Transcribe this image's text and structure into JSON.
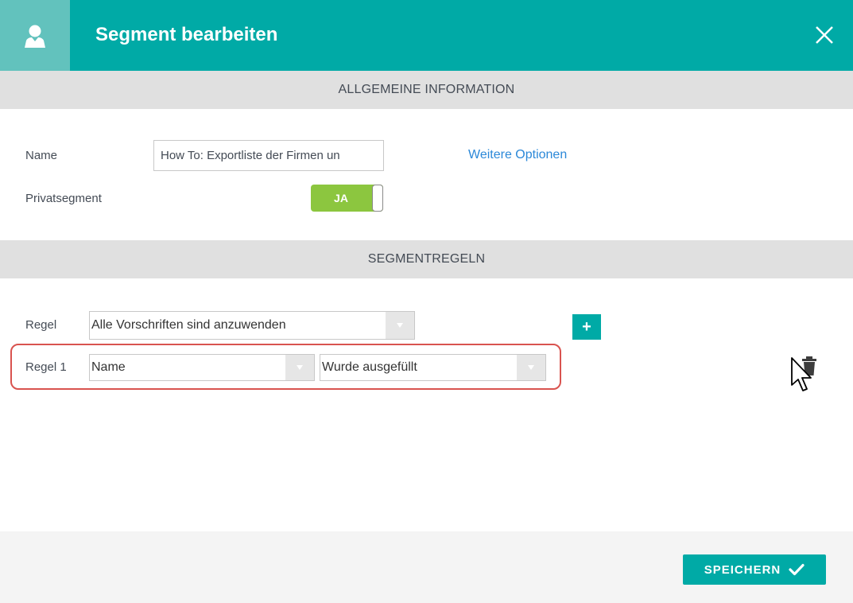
{
  "header": {
    "title": "Segment bearbeiten"
  },
  "sections": {
    "general": "ALLGEMEINE INFORMATION",
    "rules": "SEGMENTREGELN"
  },
  "general": {
    "name_label": "Name",
    "name_value": "How To: Exportliste der Firmen un",
    "more_options_link": "Weitere Optionen",
    "private_label": "Privatsegment",
    "private_toggle": "JA"
  },
  "rules": {
    "rule_label": "Regel",
    "rule_select_value": "Alle Vorschriften sind anzuwenden",
    "rule1_label": "Regel 1",
    "rule1_field_value": "Name",
    "rule1_condition_value": "Wurde ausgefüllt",
    "add_button": "+"
  },
  "footer": {
    "save_label": "SPEICHERN"
  },
  "colors": {
    "accent": "#00aaa6",
    "toggle_on": "#8cc63f",
    "link": "#2b88d8",
    "highlight": "#d9534f"
  }
}
